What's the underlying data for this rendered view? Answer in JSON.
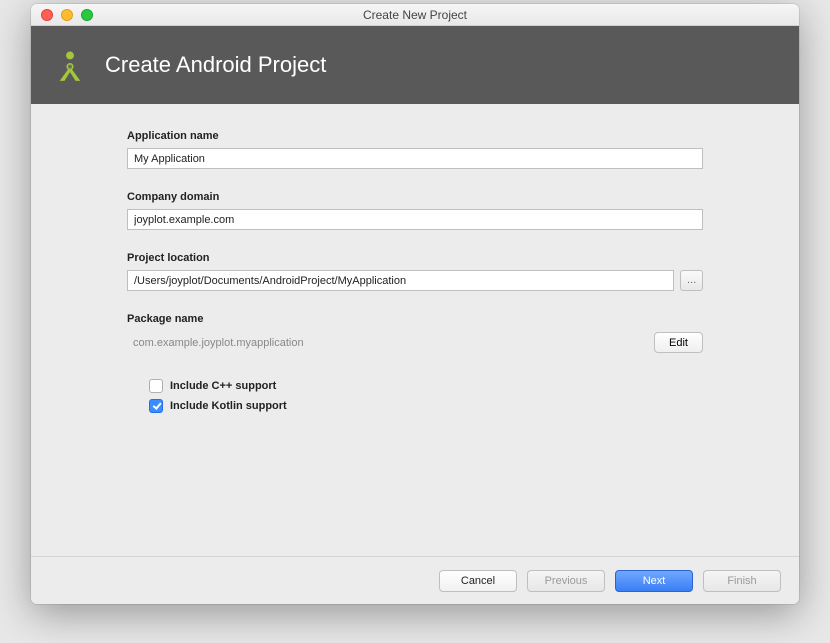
{
  "window": {
    "title": "Create New Project"
  },
  "header": {
    "title": "Create Android Project"
  },
  "form": {
    "appName": {
      "label": "Application name",
      "value": "My Application"
    },
    "companyDomain": {
      "label": "Company domain",
      "value": "joyplot.example.com"
    },
    "projectLocation": {
      "label": "Project location",
      "value": "/Users/joyplot/Documents/AndroidProject/MyApplication",
      "browseLabel": "…"
    },
    "packageName": {
      "label": "Package name",
      "value": "com.example.joyplot.myapplication",
      "editLabel": "Edit"
    },
    "options": {
      "cpp": {
        "label": "Include C++ support",
        "checked": false
      },
      "kotlin": {
        "label": "Include Kotlin support",
        "checked": true
      }
    }
  },
  "buttons": {
    "cancel": "Cancel",
    "previous": "Previous",
    "next": "Next",
    "finish": "Finish"
  }
}
